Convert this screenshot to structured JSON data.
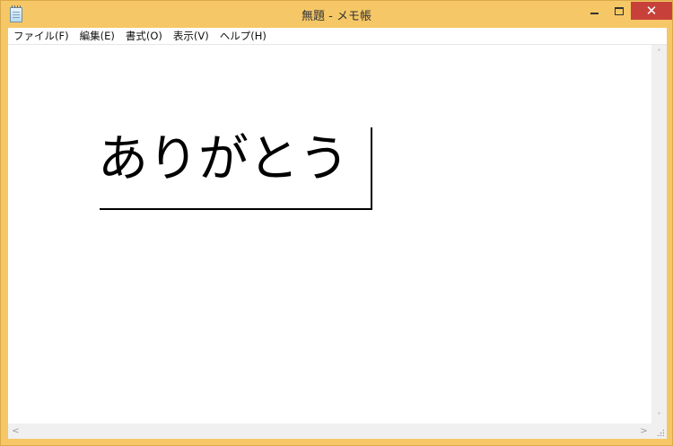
{
  "window": {
    "title": "無題 - メモ帳",
    "accent_color": "#f6c766",
    "close_color": "#c7413a",
    "icons": {
      "app": "notepad-icon",
      "minimize": "minimize-icon",
      "maximize": "maximize-icon",
      "close": "close-icon"
    },
    "close_glyph": "✕"
  },
  "menu": {
    "items": [
      {
        "label": "ファイル(F)"
      },
      {
        "label": "編集(E)"
      },
      {
        "label": "書式(O)"
      },
      {
        "label": "表示(V)"
      },
      {
        "label": "ヘルプ(H)"
      }
    ]
  },
  "editor": {
    "text": "ありがとう"
  },
  "scrollbars": {
    "up_arrow": "˄",
    "down_arrow": "˅",
    "left_arrow": "<",
    "right_arrow": ">"
  }
}
